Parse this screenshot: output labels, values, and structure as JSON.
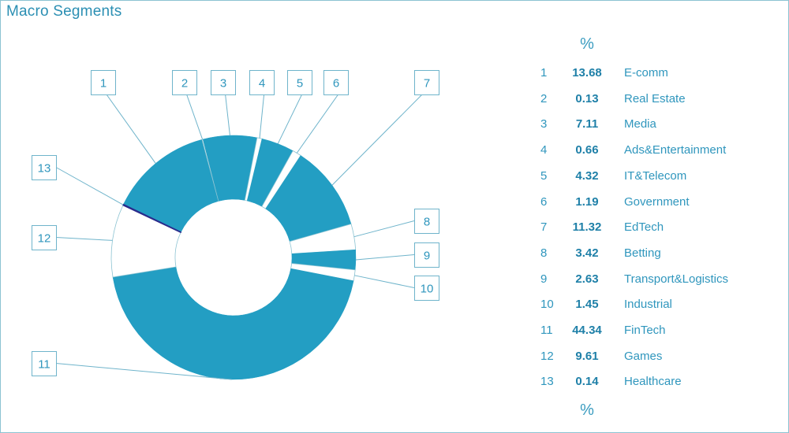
{
  "title": "Macro Segments",
  "legend": {
    "header": "%",
    "footer": "%"
  },
  "colors": {
    "filled": "#239ec3",
    "empty": "#ffffff",
    "empty_stroke": "#8cc3d2",
    "accent": "#2a2a8c",
    "text": "#2f96bd",
    "value_text": "#1f80a8",
    "frame": "#8cc3d2"
  },
  "chart_data": {
    "type": "pie",
    "subtype": "donut",
    "title": "Macro Segments",
    "unit": "%",
    "categories": [
      "E-comm",
      "Real Estate",
      "Media",
      "Ads&Entertainment",
      "IT&Telecom",
      "Government",
      "EdTech",
      "Betting",
      "Transport&Logistics",
      "Industrial",
      "FinTech",
      "Games",
      "Healthcare"
    ],
    "indices": [
      "1",
      "2",
      "3",
      "4",
      "5",
      "6",
      "7",
      "8",
      "9",
      "10",
      "11",
      "12",
      "13"
    ],
    "values": [
      13.68,
      0.13,
      7.11,
      0.66,
      4.32,
      1.19,
      11.32,
      3.42,
      2.63,
      1.45,
      44.34,
      9.61,
      0.14
    ],
    "value_labels": [
      "13.68",
      "0.13",
      "7.11",
      "0.66",
      "4.32",
      "1.19",
      "11.32",
      "3.42",
      "2.63",
      "1.45",
      "44.34",
      "9.61",
      "0.14"
    ],
    "fill_style": [
      "filled",
      "empty",
      "filled",
      "empty",
      "filled",
      "empty",
      "filled",
      "empty",
      "filled",
      "empty",
      "filled",
      "empty",
      "accent"
    ],
    "legend_placement": "right"
  }
}
